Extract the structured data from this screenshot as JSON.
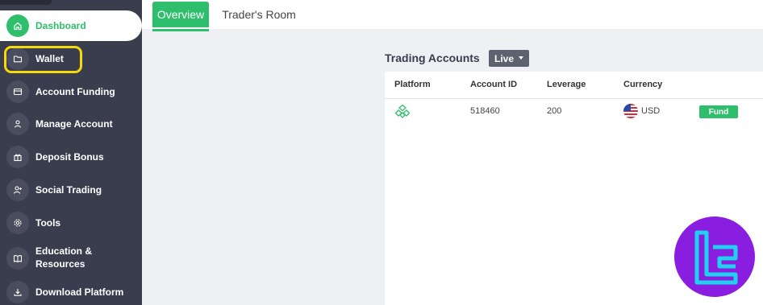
{
  "sidebar": {
    "items": [
      {
        "label": "Dashboard",
        "icon": "home-icon",
        "active": true
      },
      {
        "label": "Wallet",
        "icon": "folder-icon",
        "highlighted": true
      },
      {
        "label": "Account Funding",
        "icon": "card-icon"
      },
      {
        "label": "Manage Account",
        "icon": "user-icon"
      },
      {
        "label": "Deposit Bonus",
        "icon": "gift-icon"
      },
      {
        "label": "Social Trading",
        "icon": "user-plus-icon"
      },
      {
        "label": "Tools",
        "icon": "gear-icon"
      },
      {
        "label": "Education &",
        "label2": "Resources",
        "icon": "book-icon"
      },
      {
        "label": "Download Platform",
        "icon": "download-icon"
      }
    ]
  },
  "tabs": {
    "overview": "Overview",
    "traders_room": "Trader's Room"
  },
  "trading_accounts": {
    "title": "Trading Accounts",
    "filter": "Live",
    "columns": [
      "Platform",
      "Account ID",
      "Leverage",
      "Currency"
    ],
    "rows": [
      {
        "platform_icon": "platform-logo-icon",
        "account_id": "518460",
        "leverage": "200",
        "currency": "USD",
        "currency_flag": "us-flag-icon",
        "action": "Fund"
      }
    ]
  },
  "colors": {
    "accent": "#2fbf6c",
    "sidebar_bg": "#3a3d4e",
    "highlight": "#f5d90a",
    "badge": "#8a1ee0"
  }
}
